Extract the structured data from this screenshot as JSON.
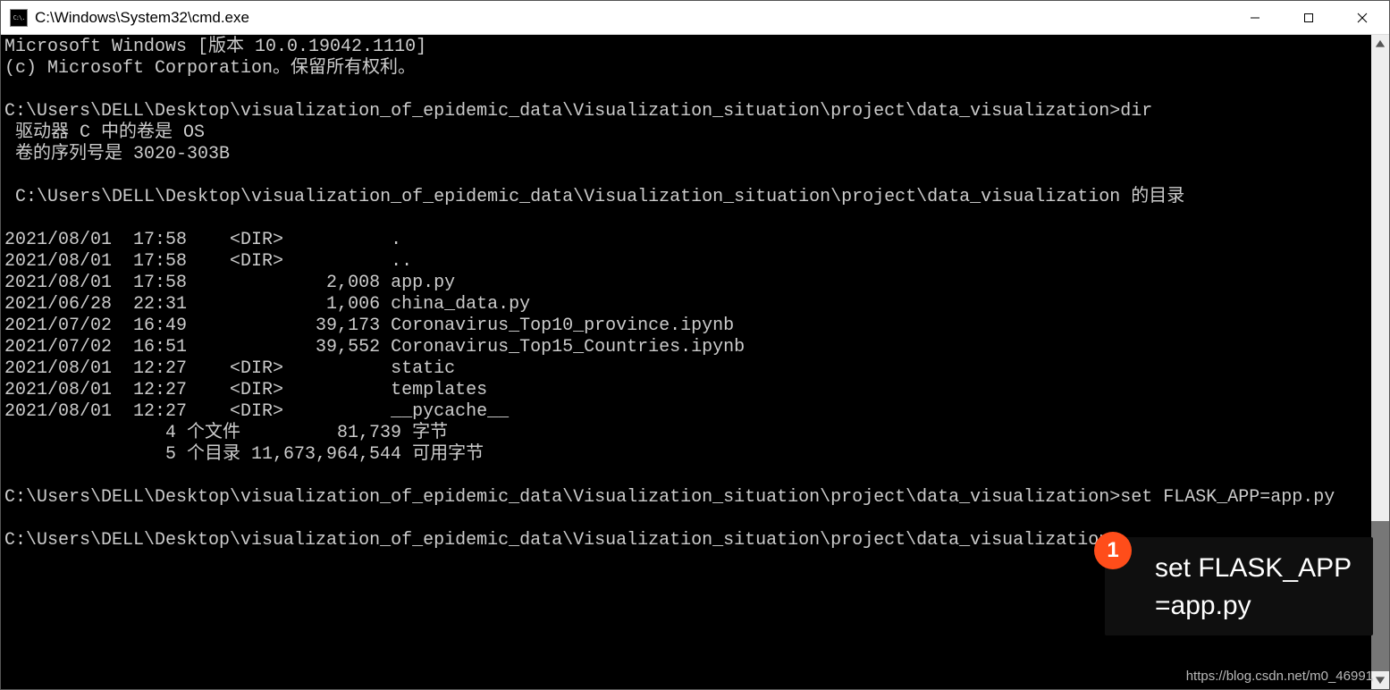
{
  "window": {
    "title": "C:\\Windows\\System32\\cmd.exe",
    "icon_label": "C:\\."
  },
  "terminal": {
    "header_line1": "Microsoft Windows [版本 10.0.19042.1110]",
    "header_line2": "(c) Microsoft Corporation。保留所有权利。",
    "prompt_path": "C:\\Users\\DELL\\Desktop\\visualization_of_epidemic_data\\Visualization_situation\\project\\data_visualization",
    "cmd1": "dir",
    "vol_line": " 驱动器 C 中的卷是 OS",
    "serial_line": " 卷的序列号是 3020-303B",
    "dir_of_line": " C:\\Users\\DELL\\Desktop\\visualization_of_epidemic_data\\Visualization_situation\\project\\data_visualization 的目录",
    "listing": [
      "2021/08/01  17:58    <DIR>          .",
      "2021/08/01  17:58    <DIR>          ..",
      "2021/08/01  17:58             2,008 app.py",
      "2021/06/28  22:31             1,006 china_data.py",
      "2021/07/02  16:49            39,173 Coronavirus_Top10_province.ipynb",
      "2021/07/02  16:51            39,552 Coronavirus_Top15_Countries.ipynb",
      "2021/08/01  12:27    <DIR>          static",
      "2021/08/01  12:27    <DIR>          templates",
      "2021/08/01  12:27    <DIR>          __pycache__"
    ],
    "summary_files": "               4 个文件         81,739 字节",
    "summary_dirs": "               5 个目录 11,673,964,544 可用字节",
    "cmd2": "set FLASK_APP=app.py",
    "cmd3_partial": ""
  },
  "annotation": {
    "number": "1",
    "line1": "set FLASK_APP",
    "line2": "=app.py"
  },
  "watermark": "https://blog.csdn.net/m0_46991"
}
